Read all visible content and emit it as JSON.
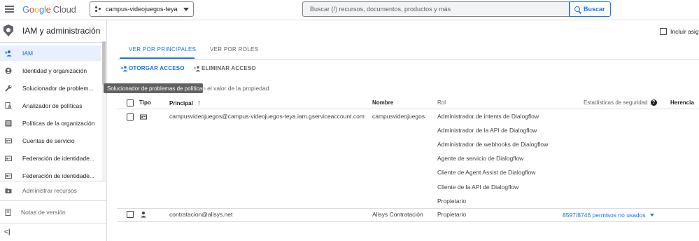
{
  "topbar": {
    "logo_google": [
      "G",
      "o",
      "o",
      "g",
      "l",
      "e"
    ],
    "logo_cloud": "Cloud",
    "project": "campus-videojuegos-teya",
    "search_placeholder": "Buscar (/) recursos, documentos, productos y más",
    "search_button": "Buscar"
  },
  "sidebar": {
    "title": "IAM y administración",
    "items": [
      {
        "label": "IAM",
        "icon": "person-add-icon",
        "active": true
      },
      {
        "label": "Identidad y organización",
        "icon": "account-circle-icon"
      },
      {
        "label": "Solucionador de problem...",
        "icon": "wrench-icon"
      },
      {
        "label": "Analizador de políticas",
        "icon": "policy-search-icon"
      },
      {
        "label": "Políticas de la organización",
        "icon": "list-alt-icon"
      },
      {
        "label": "Cuentas de servicio",
        "icon": "service-account-icon"
      },
      {
        "label": "Federación de identidade...",
        "icon": "badge-icon"
      },
      {
        "label": "Federación de identidade...",
        "icon": "badge-icon"
      }
    ],
    "manage_resources": "Administrar recursos",
    "release_notes": "Notas de versión",
    "collapse": "<|"
  },
  "main": {
    "include_label": "Incluir asig",
    "tabs": [
      "VER POR PRINCIPALES",
      "VER POR ROLES"
    ],
    "grant_access": "OTORGAR ACCESO",
    "remove_access": "ELIMINAR ACCESO",
    "filter_text": "o el valor de la propiedad",
    "tooltip": "Solucionador de problemas de políticas",
    "columns": {
      "type": "Tipo",
      "principal": "Principal",
      "name": "Nombre",
      "role": "Rol",
      "security": "Estadísticas de seguridad",
      "inheritance": "Herencia"
    },
    "rows": [
      {
        "type_icon": "service-account-icon",
        "principal": "campusvideojuegos@campus-videojuegos-teya.iam.gserviceaccount.com",
        "name": "campusvideojuegos",
        "roles": [
          "Administrador de intents de Dialogflow",
          "Administrador de la API de Dialogflow",
          "Administrador de webhooks de Dialogflow",
          "Agente de servicio de Dialogflow",
          "Cliente de Agent Assist de Dialogflow",
          "Cliente de la API de Dialogflow",
          "Propietario"
        ]
      },
      {
        "type_icon": "person-icon",
        "principal": "contratacion@alisys.net",
        "name": "Alisys Contratación",
        "roles": [
          "Propietario"
        ],
        "security": "8597/8746 permisos no usados"
      }
    ]
  },
  "colors": {
    "accent": "#1a73e8",
    "active_bg": "#e8f0fe",
    "tooltip_bg": "#616161",
    "divider": "#dadce0"
  }
}
